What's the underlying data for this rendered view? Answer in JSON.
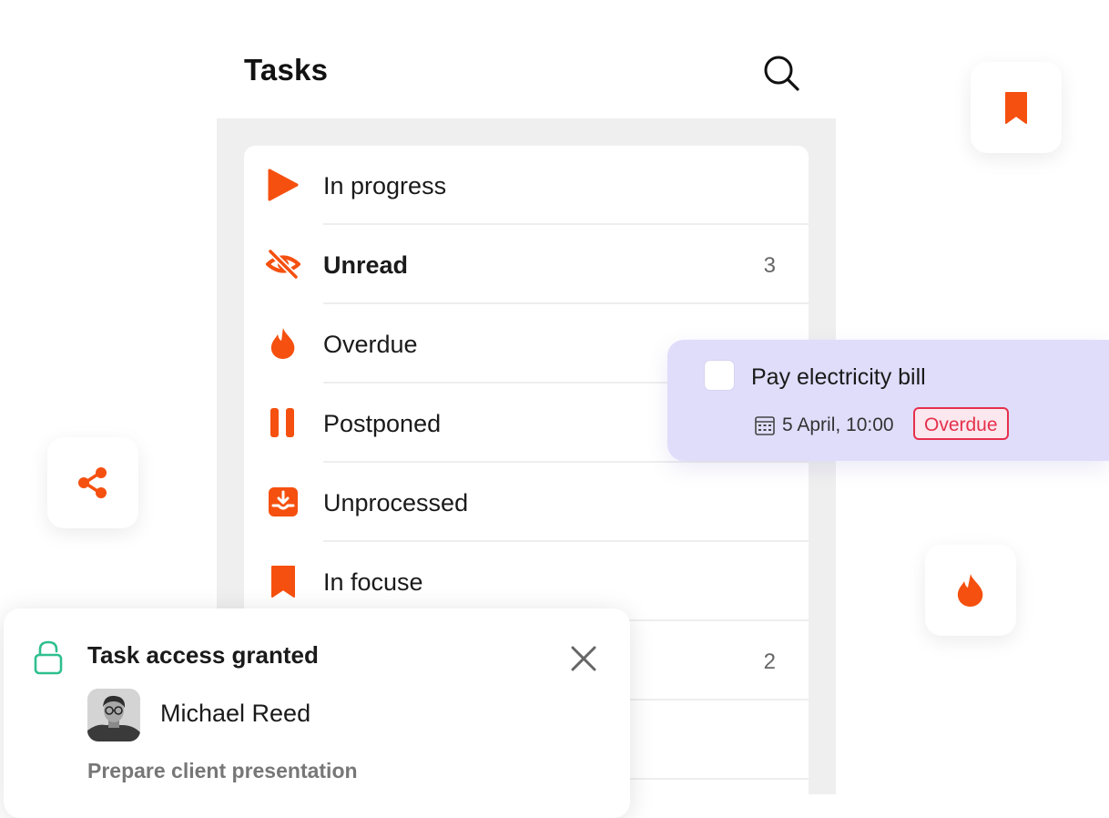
{
  "header": {
    "title": "Tasks",
    "search_icon": "search-icon"
  },
  "menu": {
    "accent_color": "#f5500f",
    "items": [
      {
        "label": "In progress",
        "icon": "play-icon",
        "count": ""
      },
      {
        "label": "Unread",
        "icon": "eye-off-icon",
        "count": "3",
        "bold": true
      },
      {
        "label": "Overdue",
        "icon": "flame-icon",
        "count": ""
      },
      {
        "label": "Postponed",
        "icon": "pause-icon",
        "count": ""
      },
      {
        "label": "Unprocessed",
        "icon": "inbox-download-icon",
        "count": ""
      },
      {
        "label": "In focuse",
        "icon": "bookmark-icon",
        "count": ""
      },
      {
        "label": "",
        "icon": "",
        "count": "2"
      }
    ]
  },
  "floating_tiles": {
    "bookmark": "bookmark-icon",
    "share": "share-icon",
    "flame": "flame-icon"
  },
  "task_popup": {
    "title": "Pay electricity bill",
    "date": "5 April, 10:00",
    "status": "Overdue",
    "background": "#e0ddfb",
    "status_color": "#e5304c"
  },
  "notification": {
    "title": "Task access granted",
    "user_name": "Michael Reed",
    "task_name": "Prepare client presentation",
    "lock_color": "#2fbf8f"
  }
}
